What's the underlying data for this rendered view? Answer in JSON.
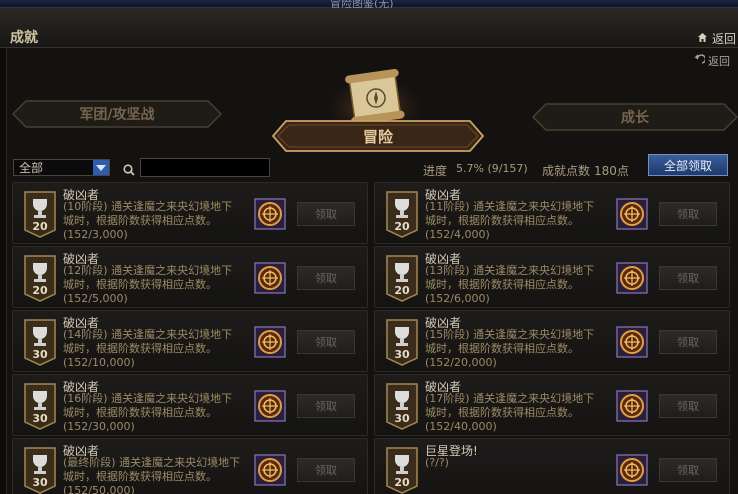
{
  "window": {
    "title": "冒险图鉴(无)"
  },
  "header": {
    "title": "成就",
    "home_label": "返回"
  },
  "nav": {
    "return_label": "返回"
  },
  "tabs": {
    "war": "军团/攻坚战",
    "adventure": "冒险",
    "growth": "成长",
    "active": "adventure"
  },
  "filter": {
    "category_value": "全部",
    "search_placeholder": ""
  },
  "stats": {
    "progress_label": "进度",
    "progress_value": "5.7% (9/157)",
    "points_label": "成就点数",
    "points_value": "180点"
  },
  "claim_all_label": "全部领取",
  "achievements": [
    {
      "title": "破凶者",
      "desc": "(10阶段) 通关逢魔之来央幻境地下城时，根据阶数获得相应点数。",
      "progress": "(152/3,000)",
      "points": "20",
      "claim": "领取"
    },
    {
      "title": "破凶者",
      "desc": "(11阶段) 通关逢魔之来央幻境地下城时，根据阶数获得相应点数。",
      "progress": "(152/4,000)",
      "points": "20",
      "claim": "领取"
    },
    {
      "title": "破凶者",
      "desc": "(12阶段) 通关逢魔之来央幻境地下城时，根据阶数获得相应点数。",
      "progress": "(152/5,000)",
      "points": "20",
      "claim": "领取"
    },
    {
      "title": "破凶者",
      "desc": "(13阶段) 通关逢魔之来央幻境地下城时，根据阶数获得相应点数。",
      "progress": "(152/6,000)",
      "points": "20",
      "claim": "领取"
    },
    {
      "title": "破凶者",
      "desc": "(14阶段) 通关逢魔之来央幻境地下城时，根据阶数获得相应点数。",
      "progress": "(152/10,000)",
      "points": "30",
      "claim": "领取"
    },
    {
      "title": "破凶者",
      "desc": "(15阶段) 通关逢魔之来央幻境地下城时，根据阶数获得相应点数。",
      "progress": "(152/20,000)",
      "points": "30",
      "claim": "领取"
    },
    {
      "title": "破凶者",
      "desc": "(16阶段) 通关逢魔之来央幻境地下城时，根据阶数获得相应点数。",
      "progress": "(152/30,000)",
      "points": "30",
      "claim": "领取"
    },
    {
      "title": "破凶者",
      "desc": "(17阶段) 通关逢魔之来央幻境地下城时，根据阶数获得相应点数。",
      "progress": "(152/40,000)",
      "points": "30",
      "claim": "领取"
    },
    {
      "title": "破凶者",
      "desc": "(最终阶段) 通关逢魔之来央幻境地下城时，根据阶数获得相应点数。",
      "progress": "(152/50,000)",
      "points": "30",
      "claim": "领取"
    },
    {
      "title": "巨星登场!",
      "desc": "(?/?)",
      "progress": "",
      "points": "20",
      "claim": "领取"
    }
  ],
  "colors": {
    "accent": "#2f5bb0",
    "gold": "#c9a264",
    "panel": "#131211"
  }
}
